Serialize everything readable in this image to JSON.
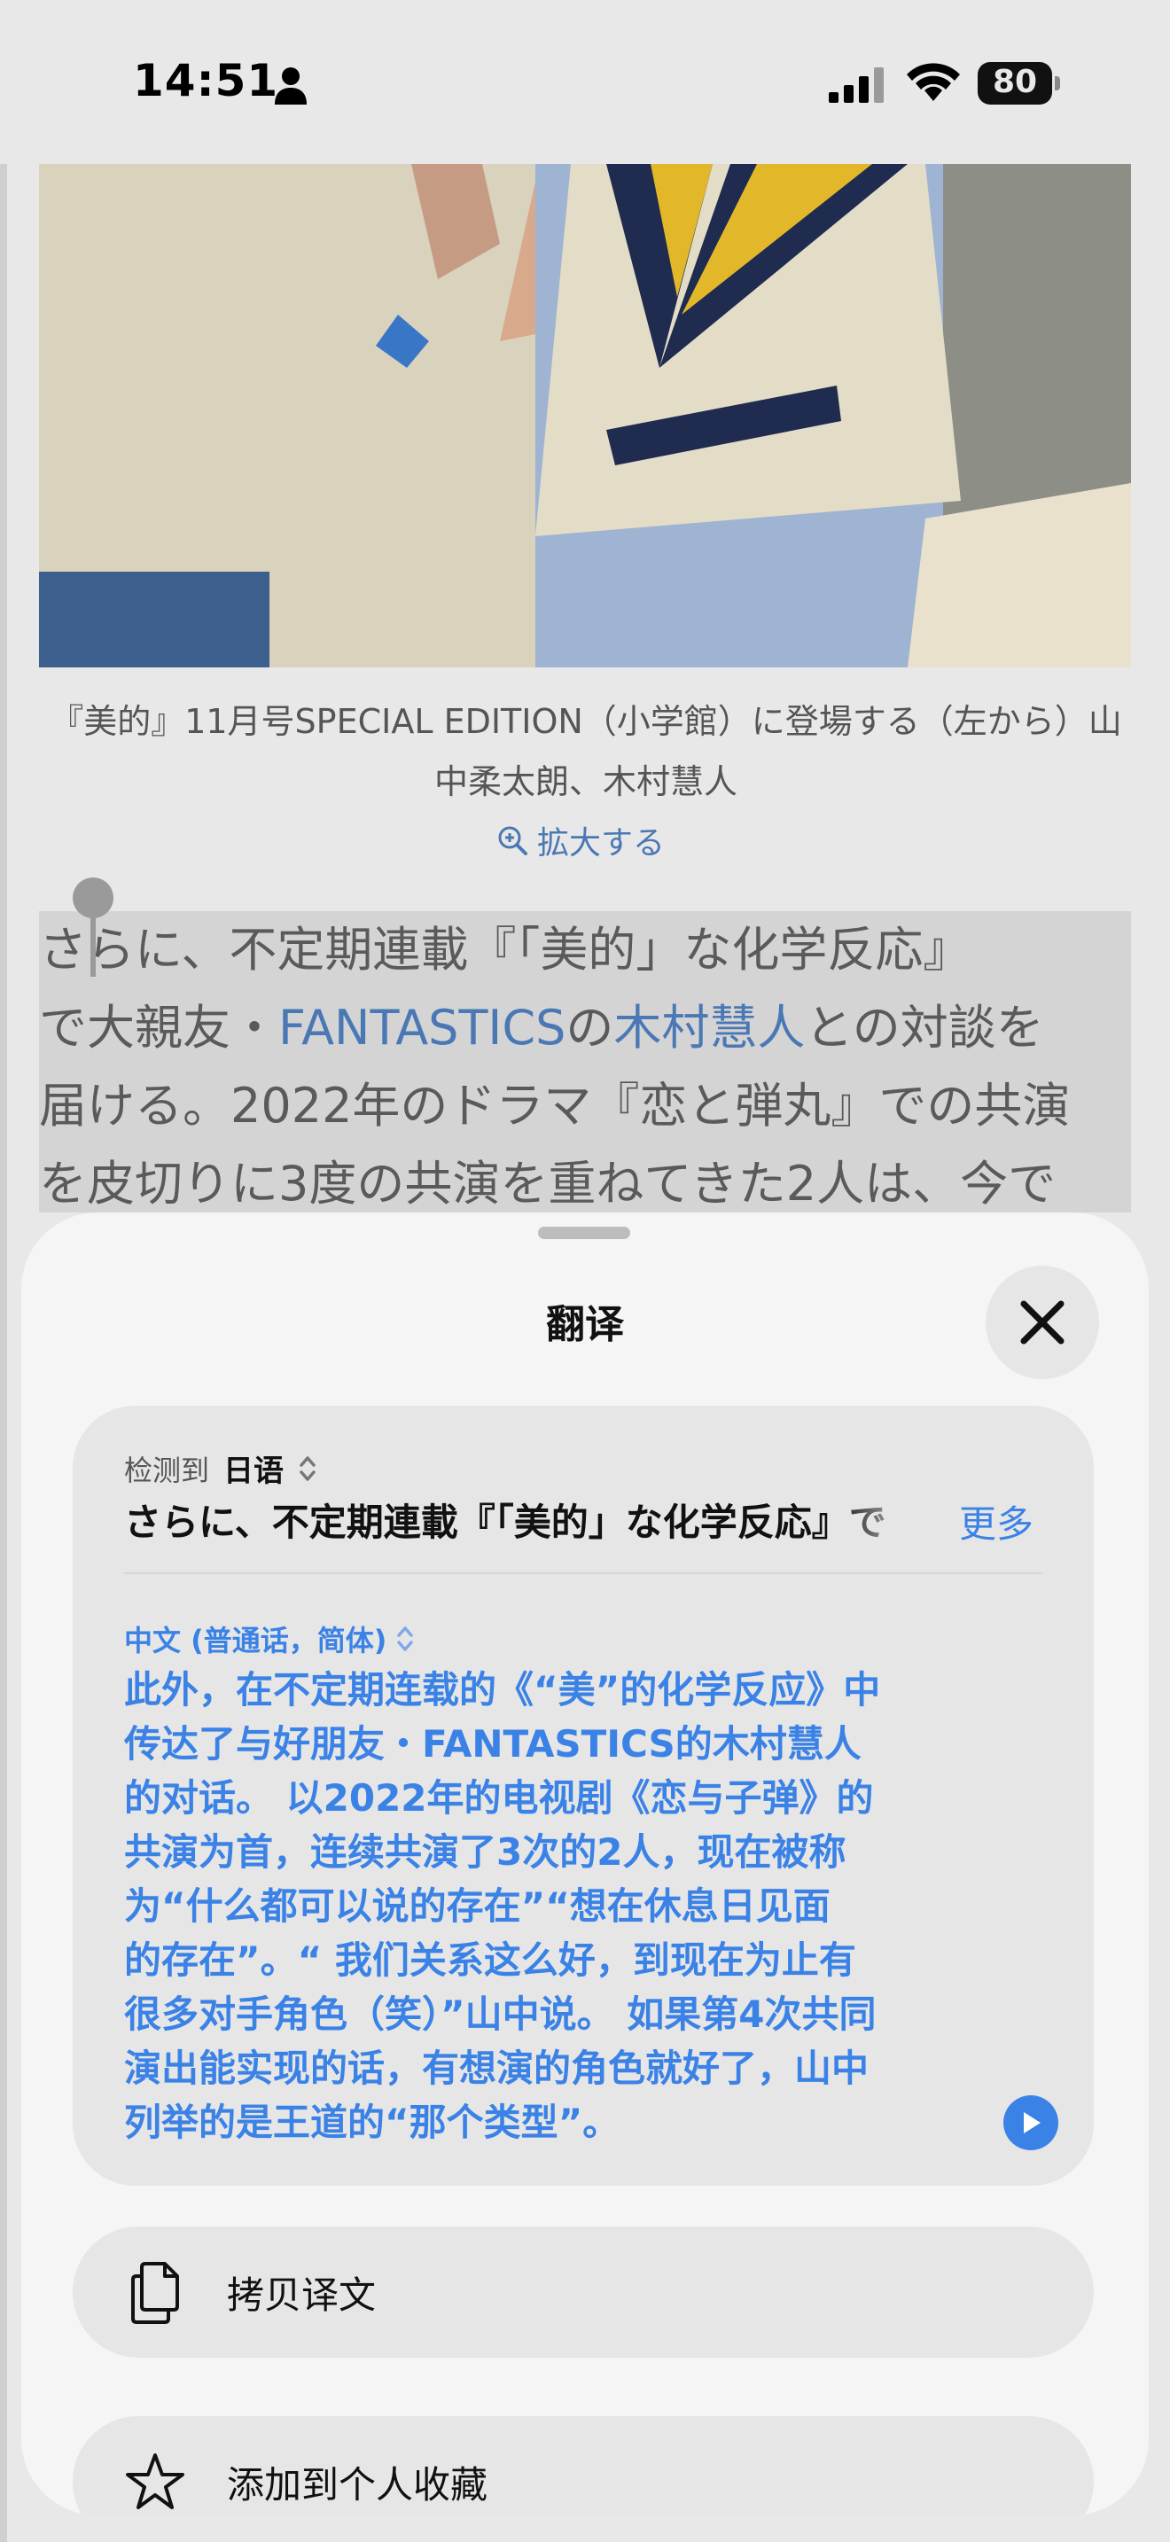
{
  "status_bar": {
    "time": "14:51",
    "battery": "80"
  },
  "article": {
    "caption": "『美的』11月号SPECIAL EDITION（小学館）に登場する（左から）山中柔太朗、木村慧人",
    "zoom_link": "拡大する",
    "paragraph_lines": [
      {
        "parts": [
          {
            "text": "さらに、不定期連載『「美的」な化学反応』",
            "link": false
          }
        ]
      },
      {
        "parts": [
          {
            "text": "で大親友・",
            "link": false
          },
          {
            "text": "FANTASTICS",
            "link": true
          },
          {
            "text": "の",
            "link": false
          },
          {
            "text": "木村慧人",
            "link": true
          },
          {
            "text": "との対談を",
            "link": false
          }
        ]
      },
      {
        "parts": [
          {
            "text": "届ける。2022年のドラマ『恋と弾丸』での共演",
            "link": false
          }
        ]
      },
      {
        "parts": [
          {
            "text": "を皮切りに3度の共演を重ねてきた2人は、今で",
            "link": false
          }
        ]
      }
    ]
  },
  "translate_sheet": {
    "title": "翻译",
    "detected_label": "检测到",
    "source_language": "日语",
    "source_text": "さらに、不定期連載『「美的」な化学反応』で",
    "more_label": "更多",
    "target_language": "中文 (普通话，简体)",
    "translation_lines": [
      "此外，在不定期连载的《“美”的化学反应》中",
      "传达了与好朋友・FANTASTICS的木村慧人",
      "的对话。 以2022年的电视剧《恋与子弹》的",
      "共演为首，连续共演了3次的2人，现在被称",
      "为“什么都可以说的存在”“想在休息日见面",
      "的存在”。“ 我们关系这么好，到现在为止有",
      "很多对手角色（笑）”山中说。 如果第4次共同",
      "演出能实现的话，有想演的角色就好了，山中",
      "列举的是王道的“那个类型”。"
    ],
    "actions": [
      {
        "label": "拷贝译文",
        "icon": "copy-icon"
      },
      {
        "label": "添加到个人收藏",
        "icon": "star-icon"
      }
    ]
  },
  "colors": {
    "accent": "#3b82e6",
    "link": "#4a78b5"
  }
}
